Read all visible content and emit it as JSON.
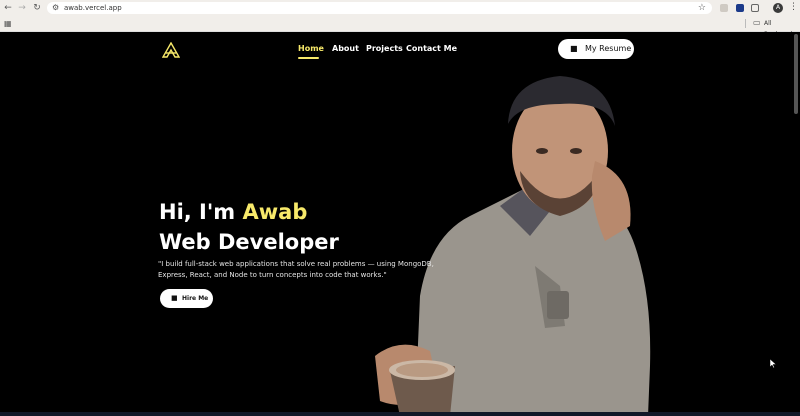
{
  "browser": {
    "url": "awab.vercel.app",
    "all_bookmarks": "All Bookmarks",
    "profile_initial": "A"
  },
  "site": {
    "nav": {
      "home": "Home",
      "about": "About",
      "projects": "Projects",
      "contact": "Contact Me"
    },
    "resume_button": "My Resume",
    "hero": {
      "greeting": "Hi, I'm ",
      "name": "Awab",
      "role": "Web Developer",
      "description": "\"I build full-stack web applications that solve real problems — using MongoDB, Express, React, and Node to turn concepts into code that works.\"",
      "hire_button": "Hire Me"
    }
  },
  "colors": {
    "accent": "#f7e96a",
    "background": "#000000"
  },
  "icons": {
    "back": "arrow-left-icon",
    "forward": "arrow-right-icon",
    "reload": "reload-icon",
    "bookmark": "star-icon",
    "apps": "apps-grid-icon",
    "folder": "folder-icon",
    "briefcase": "briefcase-icon"
  }
}
